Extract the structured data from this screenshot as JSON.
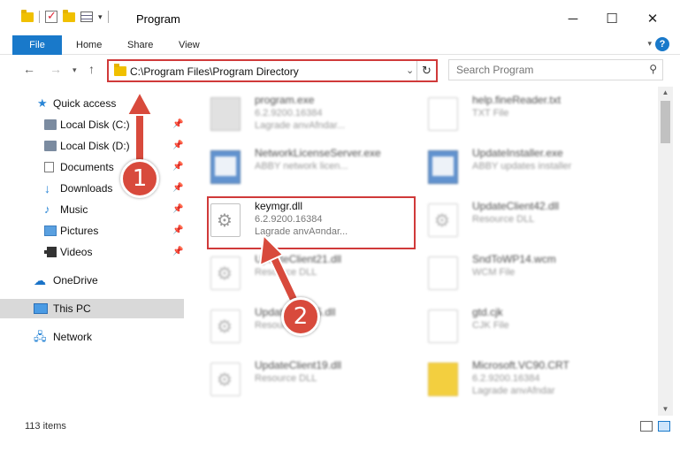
{
  "window": {
    "title": "Program",
    "controls": {
      "minimize": "─",
      "maximize": "☐",
      "close": "✕"
    }
  },
  "ribbon": {
    "tabs": [
      {
        "label": "File"
      },
      {
        "label": "Home"
      },
      {
        "label": "Share"
      },
      {
        "label": "View"
      }
    ],
    "expand_icon": "chevron-down-icon",
    "help_label": "?"
  },
  "address": {
    "path": "C:\\Program Files\\Program Directory",
    "search_placeholder": "Search Program"
  },
  "nav": {
    "items": [
      {
        "label": "Quick access",
        "icon": "star-icon"
      },
      {
        "label": "Local Disk (C:)",
        "icon": "disk-icon",
        "pinned": true
      },
      {
        "label": "Local Disk (D:)",
        "icon": "disk-icon",
        "pinned": true
      },
      {
        "label": "Documents",
        "icon": "documents-icon",
        "pinned": true
      },
      {
        "label": "Downloads",
        "icon": "download-icon",
        "pinned": true
      },
      {
        "label": "Music",
        "icon": "music-icon",
        "pinned": true
      },
      {
        "label": "Pictures",
        "icon": "pictures-icon",
        "pinned": true
      },
      {
        "label": "Videos",
        "icon": "videos-icon",
        "pinned": true
      },
      {
        "label": "OneDrive",
        "icon": "cloud-icon"
      },
      {
        "label": "This PC",
        "icon": "computer-icon",
        "selected": true
      },
      {
        "label": "Network",
        "icon": "network-icon"
      }
    ]
  },
  "files": [
    {
      "name": "program.exe",
      "line2": "6.2.9200.16384",
      "line3": "Lagrade anvAfndar...",
      "icon": "exe-icon"
    },
    {
      "name": "help.fineReader.txt",
      "line2": "TXT File",
      "line3": "",
      "icon": "page-icon"
    },
    {
      "name": "NetworkLicenseServer.exe",
      "line2": "ABBY network licen...",
      "line3": "",
      "icon": "app-icon"
    },
    {
      "name": "UpdateInstaller.exe",
      "line2": "ABBY updates installer",
      "line3": "",
      "icon": "app-icon"
    },
    {
      "name": "keymgr.dll",
      "line2": "6.2.9200.16384",
      "line3": "Lagrade anvA¤ndar...",
      "icon": "gear-icon"
    },
    {
      "name": "UpdateClient42.dll",
      "line2": "Resource DLL",
      "line3": "",
      "icon": "gear-icon"
    },
    {
      "name": "UpdateClient21.dll",
      "line2": "Resource DLL",
      "line3": "",
      "icon": "gear-icon"
    },
    {
      "name": "SndToWP14.wcm",
      "line2": "WCM File",
      "line3": "",
      "icon": "page-icon"
    },
    {
      "name": "UpdateClient5.dll",
      "line2": "Resource DLL",
      "line3": "",
      "icon": "gear-icon"
    },
    {
      "name": "gtd.cjk",
      "line2": "CJK File",
      "line3": "",
      "icon": "page-icon"
    },
    {
      "name": "UpdateClient19.dll",
      "line2": "Resource DLL",
      "line3": "",
      "icon": "gear-icon"
    },
    {
      "name": "Microsoft.VC90.CRT",
      "line2": "6.2.9200.16384",
      "line3": "Lagrade anvAfndar",
      "icon": "folder-icon"
    }
  ],
  "status": {
    "item_count": "113 items"
  },
  "annotations": {
    "step1": "1",
    "step2": "2"
  },
  "colors": {
    "accent": "#1979ca",
    "annotation_red": "#d03a3a",
    "badge_red": "#d84a3c",
    "folder_yellow": "#f0c000"
  }
}
